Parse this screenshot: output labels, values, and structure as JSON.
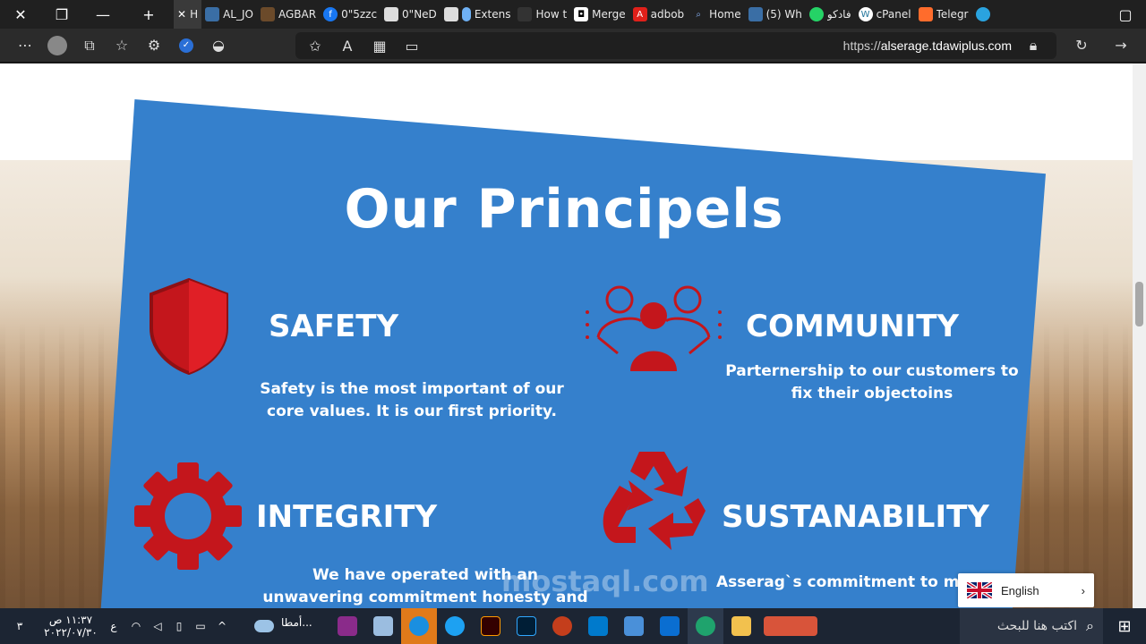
{
  "browser": {
    "tabs": [
      {
        "label": "H",
        "active": true
      },
      {
        "label": "AL_JO"
      },
      {
        "label": "AGBAR"
      },
      {
        "label": "0\"5zzc"
      },
      {
        "label": "0\"NeD"
      },
      {
        "label": "Extens"
      },
      {
        "label": "How t"
      },
      {
        "label": "Merge"
      },
      {
        "label": "adbob"
      },
      {
        "label": "Home"
      },
      {
        "label": "(5) Wh"
      },
      {
        "label": "فادكو"
      },
      {
        "label": "cPanel"
      },
      {
        "label": "Telegr"
      }
    ],
    "url_prefix": "https://",
    "url_host": "alserage.tdawiplus.com"
  },
  "page": {
    "title": "Our Principels",
    "principles": [
      {
        "name": "SAFETY",
        "desc": "Safety is the most important of our core values. It is our first priority.",
        "icon": "shield-icon"
      },
      {
        "name": "COMMUNITY",
        "desc": "Parternership to our customers to fix their objectoins",
        "icon": "community-icon"
      },
      {
        "name": "INTEGRITY",
        "desc": "We have operated with an unwavering commitment honesty and integrity.",
        "icon": "gear-icon"
      },
      {
        "name": "SUSTANABILITY",
        "desc": "Asserag`s commitment to me factories and sustainability is",
        "icon": "recycle-icon"
      }
    ],
    "watermark": "mostaql.com",
    "language_selector": "English",
    "colors": {
      "card": "#3580cc",
      "icon_red": "#c4161c"
    }
  },
  "taskbar": {
    "search_placeholder": "اكتب هنا للبحث",
    "weather": "أمطا...",
    "time": "١١:٣٧ ص",
    "date": "٢٠٢٢/٠٧/٣٠",
    "lang": "ع",
    "notifications": "٣"
  }
}
